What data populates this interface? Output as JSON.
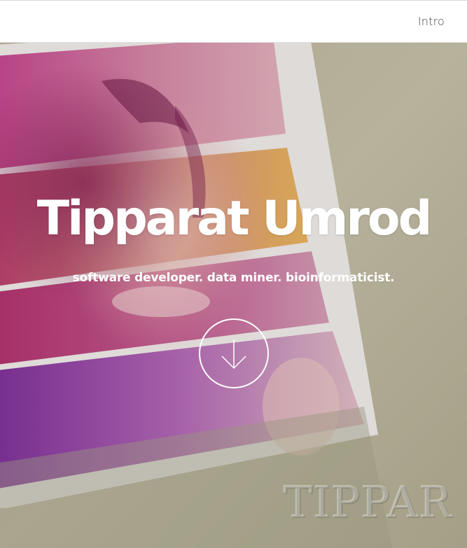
{
  "nav": {
    "intro_label": "Intro"
  },
  "hero": {
    "title": "Tipparat Umrod",
    "subtitle": "software developer. data miner. bioinformaticist.",
    "watermark_text": "TIPPAR",
    "scroll_icon": "arrow-down-icon"
  },
  "colors": {
    "background_olive": "#b7b398",
    "photo_magenta": "#c8327e",
    "photo_purple": "#8a3aa8",
    "photo_orange": "#e9a14d",
    "text_white": "#ffffff",
    "nav_text": "#444444"
  }
}
